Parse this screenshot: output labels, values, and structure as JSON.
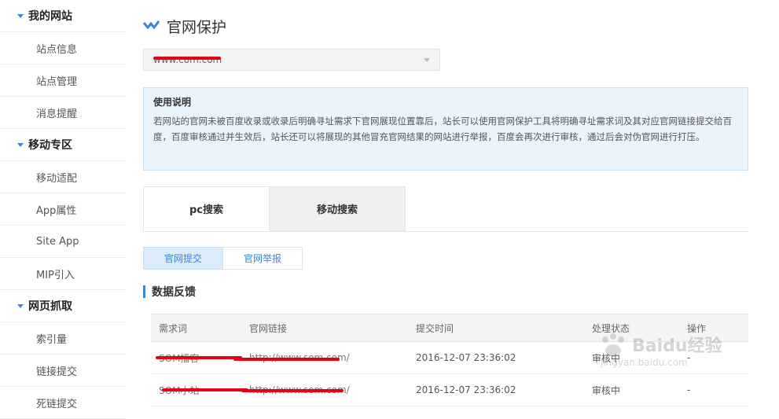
{
  "sidebar": {
    "sections": [
      {
        "title": "我的网站",
        "items": [
          "站点信息",
          "站点管理",
          "消息提醒"
        ]
      },
      {
        "title": "移动专区",
        "items": [
          "移动适配",
          "App属性",
          "Site App",
          "MIP引入"
        ]
      },
      {
        "title": "网页抓取",
        "items": [
          "索引量",
          "链接提交",
          "死链提交"
        ]
      }
    ]
  },
  "page": {
    "title": "官网保护",
    "site_select_value": "www.com.com"
  },
  "notice": {
    "title": "使用说明",
    "body": "若网站的官网未被百度收录或收录后明确寻址需求下官网展现位置靠后，站长可以使用官网保护工具将明确寻址需求词及其对应官网链接提交给百度，百度审核通过并生效后，站长还可以将展现的其他冒充官网结果的网站进行举报，百度会再次进行审核，通过后会对伪官网进行打压。"
  },
  "tabs": {
    "big": [
      "pc搜索",
      "移动搜索"
    ],
    "small": [
      "官网提交",
      "官网举报"
    ]
  },
  "feedback": {
    "title": "数据反馈",
    "columns": [
      "需求词",
      "官网链接",
      "提交时间",
      "处理状态",
      "操作"
    ],
    "rows": [
      {
        "keyword": "SOM播客",
        "url": "http://www.som.com/",
        "time": "2016-12-07 23:36:02",
        "status": "审核中",
        "action": "-"
      },
      {
        "keyword": "SOM小站",
        "url": "http://www.som.com/",
        "time": "2016-12-07 23:36:02",
        "status": "审核中",
        "action": "-"
      }
    ]
  },
  "watermark": {
    "brand": "Baidu经验",
    "url": "jingyan.baidu.com"
  },
  "colors": {
    "accent": "#3a86d8",
    "redaction": "#e60012",
    "notice_bg": "#eaf4fd"
  }
}
